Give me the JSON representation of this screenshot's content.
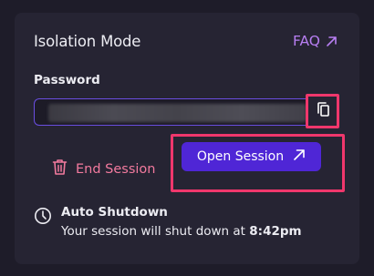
{
  "panel": {
    "title": "Isolation Mode",
    "faq_label": "FAQ"
  },
  "password": {
    "label": "Password",
    "value_state": "obscured"
  },
  "actions": {
    "end_session_label": "End Session",
    "open_session_label": "Open Session"
  },
  "shutdown": {
    "title": "Auto Shutdown",
    "text_prefix": "Your session will shut down at",
    "time": "8:42pm"
  },
  "colors": {
    "accent_purple": "#4f26d6",
    "faq_link": "#b77ef2",
    "danger_text": "#f27a9e",
    "highlight_box": "#f0376c"
  },
  "icons": {
    "faq": "external-arrow-icon",
    "copy": "copy-icon",
    "end_session": "trash-icon",
    "open_session": "external-arrow-icon",
    "shutdown": "clock-icon"
  }
}
